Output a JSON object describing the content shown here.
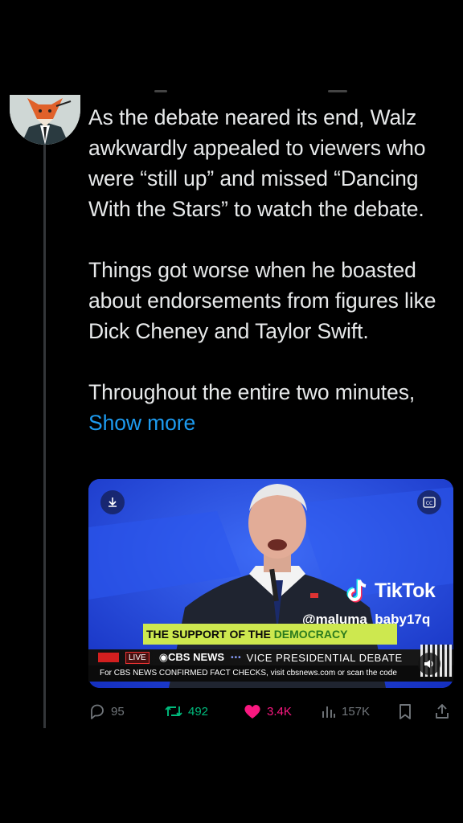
{
  "tweet": {
    "paragraphs": [
      "As the debate neared its end, Walz awkwardly appealed to viewers who were “still up” and missed “Dancing With the Stars” to watch the debate.",
      "Things got worse when he boasted about endorsements from figures like Dick Cheney and Taylor Swift.",
      "Throughout the entire two minutes,"
    ],
    "show_more": "Show more"
  },
  "media": {
    "tiktok_brand": "TikTok",
    "tiktok_user": "@maluma_baby17q",
    "caption_prefix": "THE SUPPORT OF THE ",
    "caption_highlight": "DEMOCRACY",
    "live_label": "LIVE",
    "network": "CBS NEWS",
    "dots": "•••",
    "program": "VICE PRESIDENTIAL DEBATE",
    "fact_bar": "For CBS NEWS CONFIRMED FACT CHECKS, visit cbsnews.com or scan the code"
  },
  "actions": {
    "replies": "95",
    "retweets": "492",
    "likes": "3.4K",
    "views": "157K"
  },
  "colors": {
    "background": "#000000",
    "text": "#e7e9ea",
    "link": "#1d9bf0",
    "retweet": "#00ba7c",
    "like": "#f91880",
    "muted": "#71767b",
    "caption_bg": "#cde84f"
  },
  "icons": [
    "download-icon",
    "closed-captions-icon",
    "tiktok-note-icon",
    "volume-icon",
    "reply-icon",
    "retweet-icon",
    "heart-icon",
    "views-icon",
    "bookmark-icon",
    "share-icon"
  ]
}
